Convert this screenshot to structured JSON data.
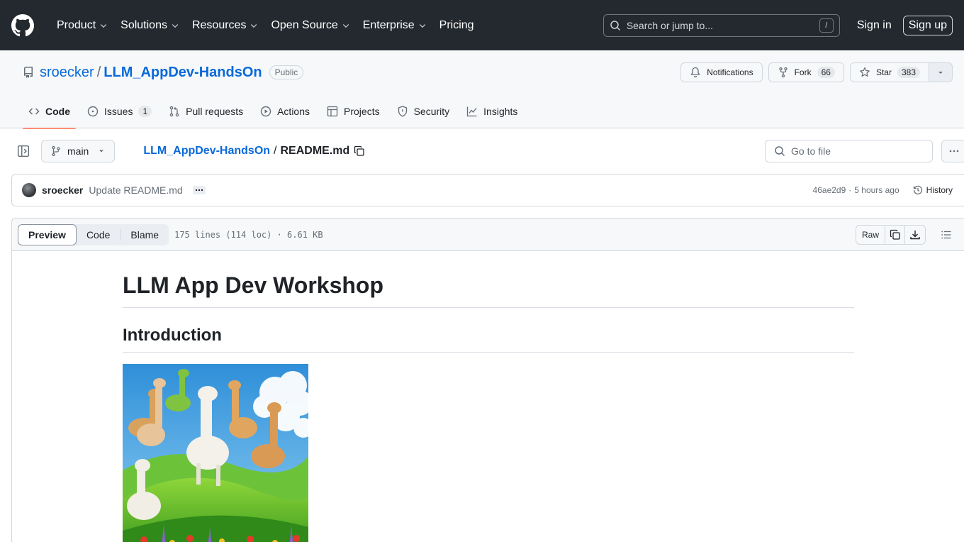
{
  "header": {
    "nav": [
      {
        "label": "Product",
        "dropdown": true
      },
      {
        "label": "Solutions",
        "dropdown": true
      },
      {
        "label": "Resources",
        "dropdown": true
      },
      {
        "label": "Open Source",
        "dropdown": true
      },
      {
        "label": "Enterprise",
        "dropdown": true
      },
      {
        "label": "Pricing",
        "dropdown": false
      }
    ],
    "search_placeholder": "Search or jump to...",
    "search_shortcut": "/",
    "sign_in": "Sign in",
    "sign_up": "Sign up"
  },
  "repo": {
    "owner": "sroecker",
    "separator": "/",
    "name": "LLM_AppDev-HandsOn",
    "visibility": "Public",
    "notifications_label": "Notifications",
    "fork_label": "Fork",
    "fork_count": "66",
    "star_label": "Star",
    "star_count": "383"
  },
  "tabs": [
    {
      "label": "Code",
      "icon": "code-icon",
      "active": true
    },
    {
      "label": "Issues",
      "icon": "issue-icon",
      "count": "1"
    },
    {
      "label": "Pull requests",
      "icon": "pull-request-icon"
    },
    {
      "label": "Actions",
      "icon": "play-icon"
    },
    {
      "label": "Projects",
      "icon": "table-icon"
    },
    {
      "label": "Security",
      "icon": "shield-icon"
    },
    {
      "label": "Insights",
      "icon": "graph-icon"
    }
  ],
  "file_bar": {
    "branch": "main",
    "crumb_repo": "LLM_AppDev-HandsOn",
    "crumb_sep": "/",
    "crumb_file": "README.md",
    "goto_placeholder": "Go to file"
  },
  "commit": {
    "author": "sroecker",
    "message": "Update README.md",
    "sha": "46ae2d9",
    "dot": "·",
    "time": "5 hours ago",
    "history_label": "History"
  },
  "file_view": {
    "modes": [
      "Preview",
      "Code",
      "Blame"
    ],
    "active_mode": "Preview",
    "meta": "175 lines (114 loc) · 6.61 KB",
    "raw_label": "Raw"
  },
  "readme": {
    "title": "LLM App Dev Workshop",
    "section": "Introduction"
  },
  "colors": {
    "header_bg": "#24292f",
    "link": "#0969da",
    "active_tab_underline": "#fd8c73"
  }
}
